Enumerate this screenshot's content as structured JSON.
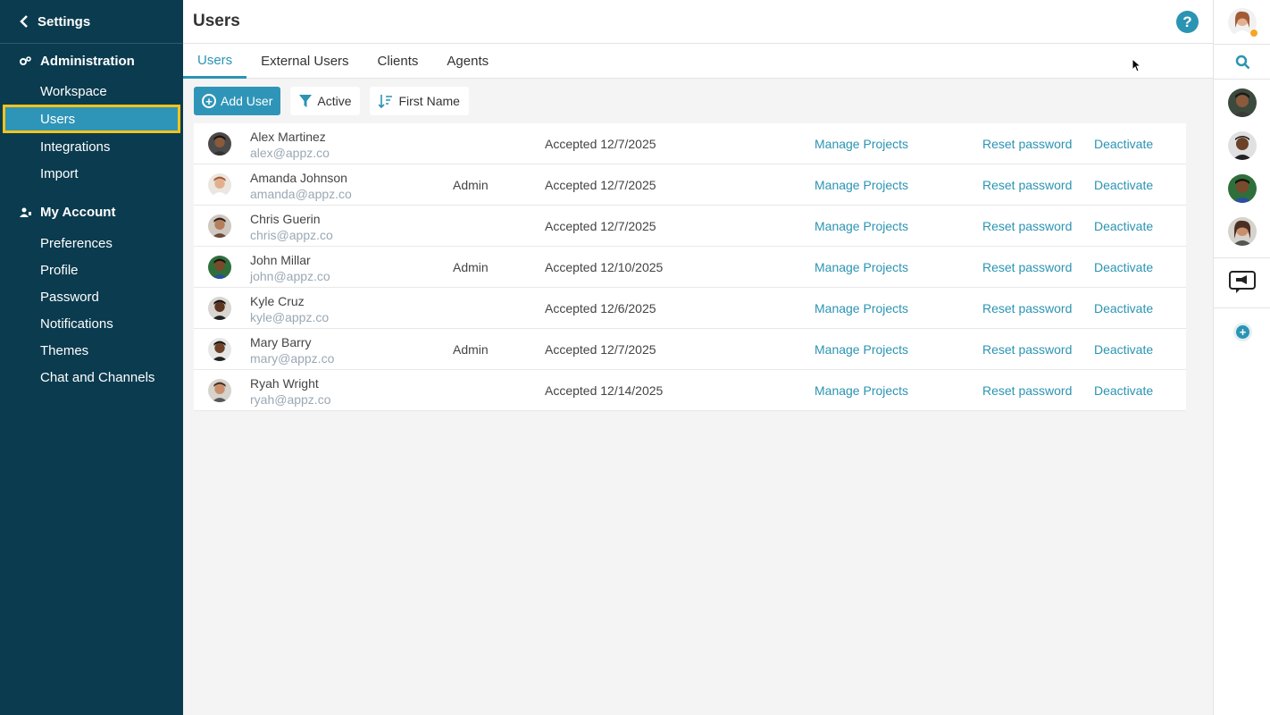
{
  "sidebar": {
    "back_label": "Settings",
    "sections": [
      {
        "title": "Administration",
        "icon": "gears-icon",
        "items": [
          "Workspace",
          "Users",
          "Integrations",
          "Import"
        ]
      },
      {
        "title": "My Account",
        "icon": "user-icon",
        "items": [
          "Preferences",
          "Profile",
          "Password",
          "Notifications",
          "Themes",
          "Chat and Channels"
        ]
      }
    ],
    "active_item": "Users"
  },
  "header": {
    "title": "Users",
    "help_label": "?"
  },
  "tabs": [
    "Users",
    "External Users",
    "Clients",
    "Agents"
  ],
  "toolbar": {
    "add_label": "Add User",
    "filter_label": "Active",
    "sort_label": "First Name"
  },
  "users": [
    {
      "name": "Alex Martinez",
      "email": "alex@appz.co",
      "role": "",
      "status": "Accepted 12/7/2025"
    },
    {
      "name": "Amanda Johnson",
      "email": "amanda@appz.co",
      "role": "Admin",
      "status": "Accepted 12/7/2025"
    },
    {
      "name": "Chris Guerin",
      "email": "chris@appz.co",
      "role": "",
      "status": "Accepted 12/7/2025"
    },
    {
      "name": "John Millar",
      "email": "john@appz.co",
      "role": "Admin",
      "status": "Accepted 12/10/2025"
    },
    {
      "name": "Kyle Cruz",
      "email": "kyle@appz.co",
      "role": "",
      "status": "Accepted 12/6/2025"
    },
    {
      "name": "Mary Barry",
      "email": "mary@appz.co",
      "role": "Admin",
      "status": "Accepted 12/7/2025"
    },
    {
      "name": "Ryah Wright",
      "email": "ryah@appz.co",
      "role": "",
      "status": "Accepted 12/14/2025"
    }
  ],
  "row_actions": {
    "manage": "Manage Projects",
    "reset": "Reset password",
    "deactivate": "Deactivate"
  },
  "colors": {
    "sidebar_bg": "#0b3b4f",
    "accent": "#2f95b8",
    "highlight": "#f2c41a",
    "link": "#2b94b3"
  }
}
